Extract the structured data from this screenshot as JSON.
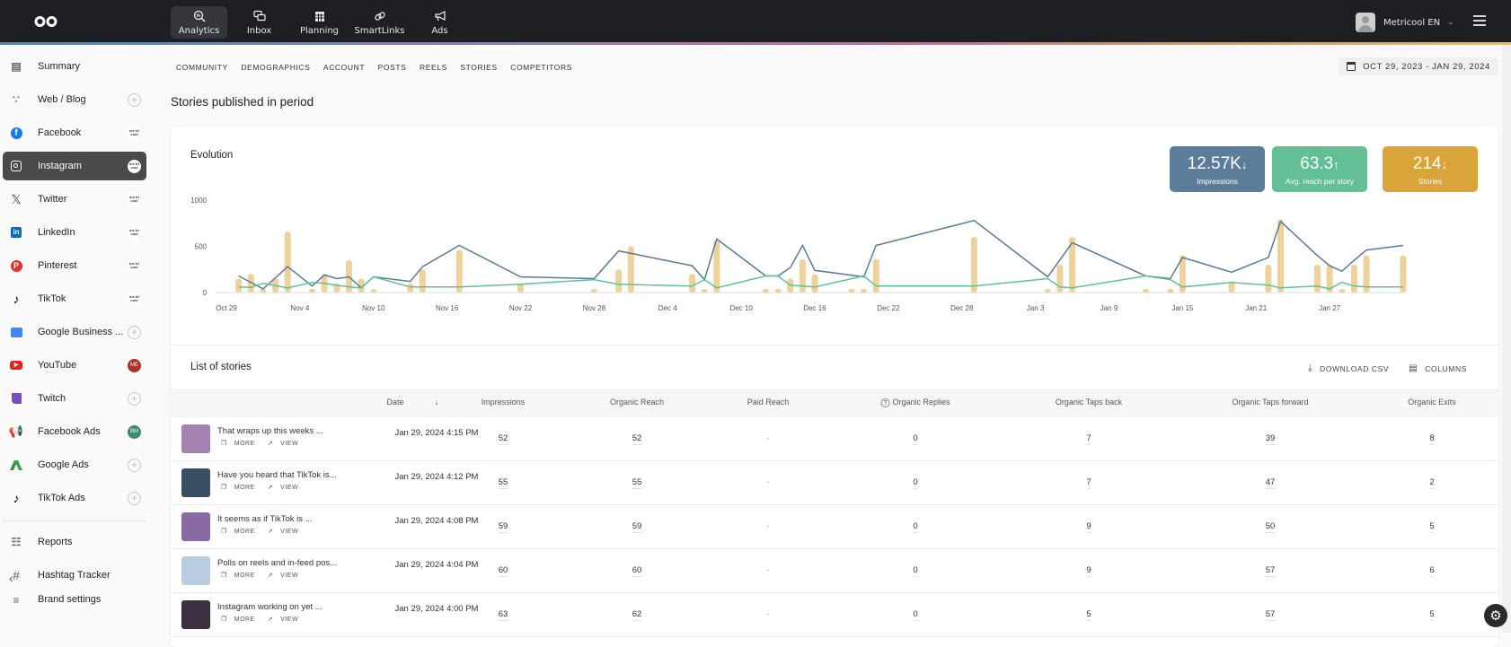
{
  "topbar": {
    "logo": "metricool-logo",
    "nav": [
      {
        "label": "Analytics",
        "icon": "analytics-icon",
        "active": true
      },
      {
        "label": "Inbox",
        "icon": "inbox-icon",
        "active": false
      },
      {
        "label": "Planning",
        "icon": "calendar-icon",
        "active": false
      },
      {
        "label": "SmartLinks",
        "icon": "link-icon",
        "active": false
      },
      {
        "label": "Ads",
        "icon": "megaphone-icon",
        "active": false
      }
    ],
    "account_name": "Metricool EN"
  },
  "sidebar": {
    "items": [
      {
        "label": "Summary",
        "icon": "clipboard-icon",
        "badge": "none"
      },
      {
        "label": "Web / Blog",
        "icon": "rss-icon",
        "badge": "plus"
      },
      {
        "label": "Facebook",
        "icon": "facebook-icon",
        "badge": "mc"
      },
      {
        "label": "Instagram",
        "icon": "instagram-icon",
        "badge": "mc",
        "active": true
      },
      {
        "label": "Twitter",
        "icon": "x-twitter-icon",
        "badge": "mc"
      },
      {
        "label": "LinkedIn",
        "icon": "linkedin-icon",
        "badge": "mc"
      },
      {
        "label": "Pinterest",
        "icon": "pinterest-icon",
        "badge": "mc"
      },
      {
        "label": "TikTok",
        "icon": "tiktok-icon",
        "badge": "mc"
      },
      {
        "label": "Google Business ...",
        "icon": "google-business-icon",
        "badge": "plus"
      },
      {
        "label": "YouTube",
        "icon": "youtube-icon",
        "badge": "ME"
      },
      {
        "label": "Twitch",
        "icon": "twitch-icon",
        "badge": "plus"
      },
      {
        "label": "Facebook Ads",
        "icon": "facebook-ads-icon",
        "badge": "BM"
      },
      {
        "label": "Google Ads",
        "icon": "google-ads-icon",
        "badge": "plus"
      },
      {
        "label": "TikTok Ads",
        "icon": "tiktok-ads-icon",
        "badge": "plus"
      },
      {
        "label": "Reports",
        "icon": "report-icon",
        "badge": "none"
      },
      {
        "label": "Hashtag Tracker",
        "icon": "hashtag-icon",
        "badge": "none"
      },
      {
        "label": "Brand settings",
        "icon": "sliders-icon",
        "badge": "none"
      }
    ],
    "badge_mc_text": "me tri cool",
    "badge_colors": {
      "ME": "#a8332b",
      "BM": "#3b8a6e"
    }
  },
  "tabs": [
    "COMMUNITY",
    "DEMOGRAPHICS",
    "ACCOUNT",
    "POSTS",
    "REELS",
    "STORIES",
    "COMPETITORS"
  ],
  "active_tab": "STORIES",
  "date_range": "OCT 29, 2023 - JAN 29, 2024",
  "page_title": "Stories published in period",
  "evolution": {
    "title": "Evolution",
    "kpis": [
      {
        "value": "12.57K",
        "trend": "↓",
        "label": "Impressions",
        "color": "#5b7d99"
      },
      {
        "value": "63.3",
        "trend": "↑",
        "label": "Avg. reach per story",
        "color": "#63bf96"
      },
      {
        "value": "214",
        "trend": "↓",
        "label": "Stories",
        "color": "#d9a53a"
      }
    ]
  },
  "chart_data": {
    "type": "bar",
    "title": "Evolution",
    "xlabel": "",
    "ylabel": "",
    "ylim": [
      0,
      1000
    ],
    "yticks": [
      0,
      500,
      1000
    ],
    "x_range": [
      "2023-10-29",
      "2024-01-29"
    ],
    "xticks": [
      "Oct 29",
      "Nov 4",
      "Nov 10",
      "Nov 16",
      "Nov 22",
      "Nov 28",
      "Dec 4",
      "Dec 10",
      "Dec 16",
      "Dec 22",
      "Dec 28",
      "Jan 3",
      "Jan 9",
      "Jan 15",
      "Jan 21",
      "Jan 27"
    ],
    "grid": false,
    "legend": "none",
    "series": [
      {
        "name": "Impressions",
        "type": "bar",
        "color": "#eed29b",
        "points": [
          [
            1,
            150
          ],
          [
            2,
            200
          ],
          [
            3,
            40
          ],
          [
            4,
            150
          ],
          [
            5,
            660
          ],
          [
            7,
            40
          ],
          [
            8,
            200
          ],
          [
            9,
            100
          ],
          [
            10,
            350
          ],
          [
            11,
            150
          ],
          [
            12,
            40
          ],
          [
            15,
            100
          ],
          [
            16,
            250
          ],
          [
            19,
            460
          ],
          [
            24,
            100
          ],
          [
            30,
            40
          ],
          [
            32,
            250
          ],
          [
            33,
            500
          ],
          [
            38,
            200
          ],
          [
            39,
            40
          ],
          [
            40,
            560
          ],
          [
            44,
            40
          ],
          [
            45,
            40
          ],
          [
            46,
            150
          ],
          [
            47,
            360
          ],
          [
            48,
            200
          ],
          [
            51,
            40
          ],
          [
            52,
            40
          ],
          [
            53,
            360
          ],
          [
            61,
            600
          ],
          [
            67,
            40
          ],
          [
            68,
            300
          ],
          [
            69,
            600
          ],
          [
            75,
            40
          ],
          [
            77,
            40
          ],
          [
            78,
            400
          ],
          [
            82,
            120
          ],
          [
            85,
            300
          ],
          [
            86,
            790
          ],
          [
            89,
            300
          ],
          [
            90,
            300
          ],
          [
            91,
            40
          ],
          [
            92,
            300
          ],
          [
            93,
            400
          ],
          [
            96,
            400
          ]
        ]
      },
      {
        "name": "Avg. reach (blue)",
        "type": "line",
        "color": "#577a98",
        "points": [
          [
            1,
            180
          ],
          [
            3,
            40
          ],
          [
            5,
            280
          ],
          [
            7,
            70
          ],
          [
            8,
            190
          ],
          [
            9,
            150
          ],
          [
            10,
            170
          ],
          [
            11,
            50
          ],
          [
            12,
            170
          ],
          [
            15,
            120
          ],
          [
            16,
            280
          ],
          [
            19,
            510
          ],
          [
            24,
            170
          ],
          [
            30,
            150
          ],
          [
            32,
            450
          ],
          [
            38,
            290
          ],
          [
            39,
            140
          ],
          [
            40,
            580
          ],
          [
            44,
            180
          ],
          [
            45,
            180
          ],
          [
            46,
            270
          ],
          [
            47,
            510
          ],
          [
            48,
            240
          ],
          [
            52,
            170
          ],
          [
            53,
            510
          ],
          [
            61,
            780
          ],
          [
            67,
            170
          ],
          [
            69,
            540
          ],
          [
            75,
            180
          ],
          [
            77,
            150
          ],
          [
            78,
            380
          ],
          [
            82,
            220
          ],
          [
            85,
            380
          ],
          [
            86,
            770
          ],
          [
            89,
            400
          ],
          [
            90,
            290
          ],
          [
            91,
            230
          ],
          [
            92,
            350
          ],
          [
            93,
            460
          ],
          [
            96,
            510
          ]
        ]
      },
      {
        "name": "Organic reach (green)",
        "type": "line",
        "color": "#63bf96",
        "points": [
          [
            1,
            60
          ],
          [
            2,
            55
          ],
          [
            3,
            100
          ],
          [
            5,
            50
          ],
          [
            7,
            110
          ],
          [
            8,
            100
          ],
          [
            10,
            60
          ],
          [
            11,
            50
          ],
          [
            12,
            170
          ],
          [
            15,
            60
          ],
          [
            19,
            60
          ],
          [
            24,
            90
          ],
          [
            30,
            140
          ],
          [
            32,
            90
          ],
          [
            38,
            70
          ],
          [
            39,
            140
          ],
          [
            40,
            50
          ],
          [
            44,
            180
          ],
          [
            45,
            180
          ],
          [
            46,
            80
          ],
          [
            48,
            60
          ],
          [
            52,
            180
          ],
          [
            53,
            70
          ],
          [
            61,
            70
          ],
          [
            67,
            150
          ],
          [
            68,
            60
          ],
          [
            69,
            50
          ],
          [
            75,
            180
          ],
          [
            77,
            140
          ],
          [
            78,
            60
          ],
          [
            82,
            110
          ],
          [
            85,
            80
          ],
          [
            86,
            50
          ],
          [
            89,
            70
          ],
          [
            90,
            40
          ],
          [
            91,
            110
          ],
          [
            92,
            70
          ],
          [
            93,
            60
          ],
          [
            96,
            60
          ]
        ]
      }
    ]
  },
  "list": {
    "title": "List of stories",
    "download_csv": "DOWNLOAD CSV",
    "columns_btn": "COLUMNS",
    "headers": [
      "Date",
      "Impressions",
      "Organic Reach",
      "Paid Reach",
      "Organic Replies",
      "Organic Taps back",
      "Organic Taps forward",
      "Organic Exits"
    ],
    "more_label": "MORE",
    "view_label": "VIEW",
    "rows": [
      {
        "text": "That wraps up this weeks ...",
        "date": "Jan 29, 2024 4:15 PM",
        "impressions": "52",
        "organic_reach": "52",
        "paid_reach": "-",
        "organic_replies": "0",
        "taps_back": "7",
        "taps_forward": "39",
        "exits": "8",
        "thumb": "#a482b0"
      },
      {
        "text": "Have you heard that TikTok is...",
        "date": "Jan 29, 2024 4:12 PM",
        "impressions": "55",
        "organic_reach": "55",
        "paid_reach": "-",
        "organic_replies": "0",
        "taps_back": "7",
        "taps_forward": "47",
        "exits": "2",
        "thumb": "#3a4f66"
      },
      {
        "text": "It seems as if TikTok is ...",
        "date": "Jan 29, 2024 4:08 PM",
        "impressions": "59",
        "organic_reach": "59",
        "paid_reach": "-",
        "organic_replies": "0",
        "taps_back": "9",
        "taps_forward": "50",
        "exits": "5",
        "thumb": "#8a6aa2"
      },
      {
        "text": "Polls on reels and in-feed pos...",
        "date": "Jan 29, 2024 4:04 PM",
        "impressions": "60",
        "organic_reach": "60",
        "paid_reach": "-",
        "organic_replies": "0",
        "taps_back": "9",
        "taps_forward": "57",
        "exits": "6",
        "thumb": "#b8cde0"
      },
      {
        "text": "Instagram working on yet ...",
        "date": "Jan 29, 2024 4:00 PM",
        "impressions": "63",
        "organic_reach": "62",
        "paid_reach": "-",
        "organic_replies": "0",
        "taps_back": "5",
        "taps_forward": "57",
        "exits": "5",
        "thumb": "#3a3040"
      }
    ]
  }
}
